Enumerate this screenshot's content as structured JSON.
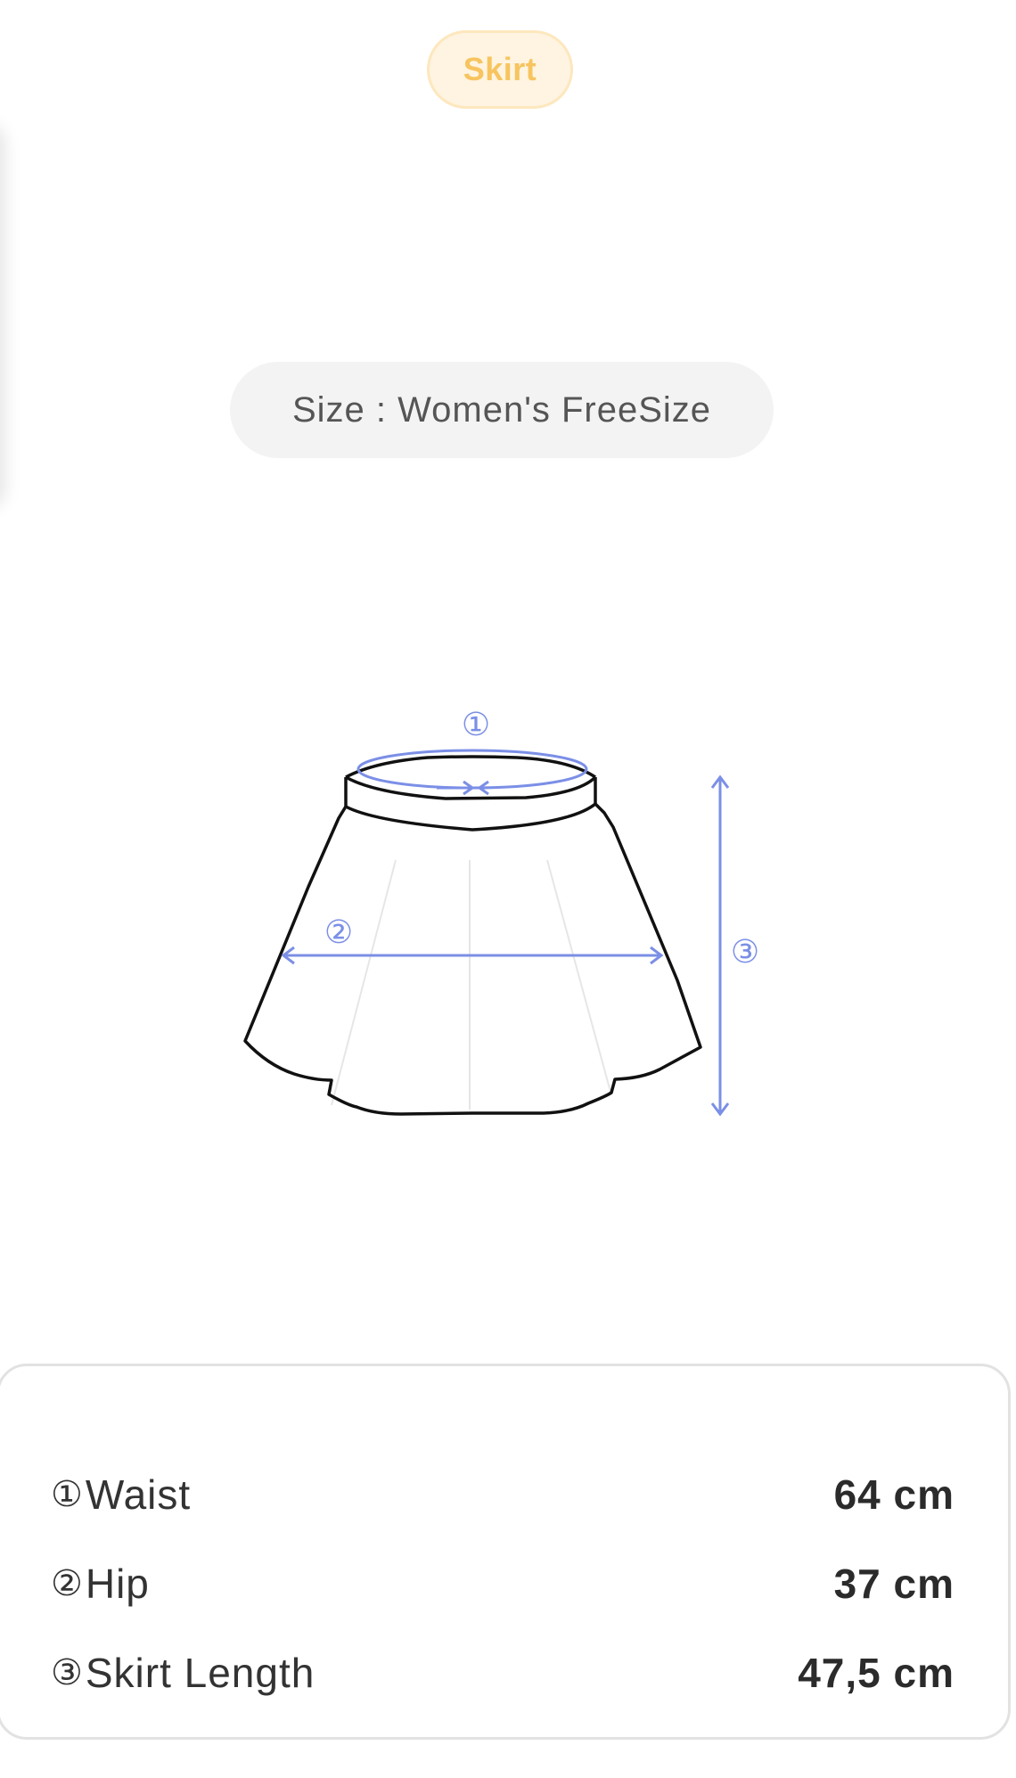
{
  "category": {
    "label": "Skirt",
    "color": "#f7c45f",
    "background": "#fff4e1"
  },
  "size_tag": {
    "text": "Size : Women's FreeSize"
  },
  "diagram": {
    "garment": "skirt",
    "accent_color": "#7b8fe6",
    "markers": [
      "①",
      "②",
      "③"
    ]
  },
  "measurements": [
    {
      "index": "①",
      "name": "Waist",
      "value": "64 cm"
    },
    {
      "index": "②",
      "name": "Hip",
      "value": "37 cm"
    },
    {
      "index": "③",
      "name": "Skirt Length",
      "value": "47,5 cm"
    }
  ]
}
